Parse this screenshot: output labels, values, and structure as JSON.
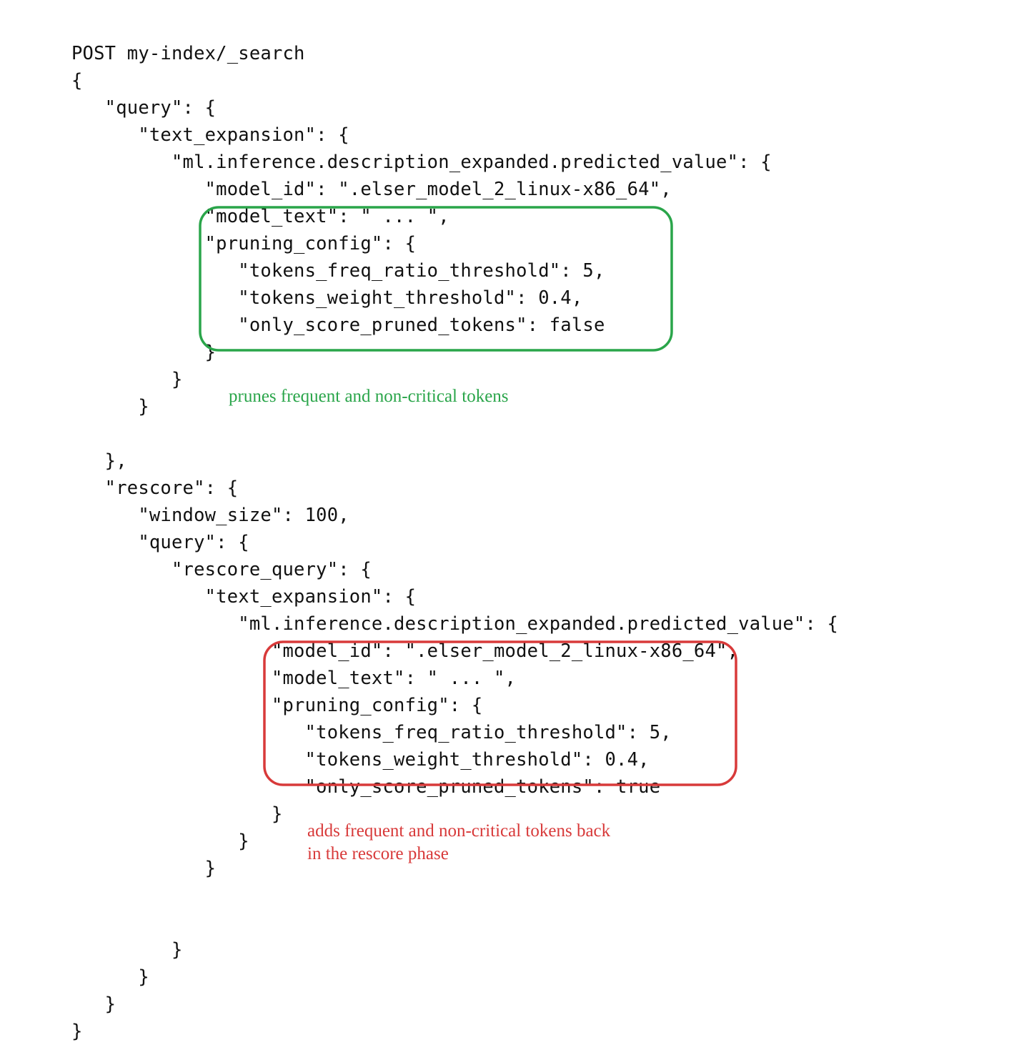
{
  "code_lines": [
    "POST my-index/_search",
    "{",
    "   \"query\": {",
    "      \"text_expansion\": {",
    "         \"ml.inference.description_expanded.predicted_value\": {",
    "            \"model_id\": \".elser_model_2_linux-x86_64\",",
    "            \"model_text\": \" ... \",",
    "            \"pruning_config\": {",
    "               \"tokens_freq_ratio_threshold\": 5,",
    "               \"tokens_weight_threshold\": 0.4,",
    "               \"only_score_pruned_tokens\": false",
    "            }",
    "         }",
    "      }",
    "   },",
    "   \"rescore\": {",
    "      \"window_size\": 100,",
    "      \"query\": {",
    "         \"rescore_query\": {",
    "            \"text_expansion\": {",
    "               \"ml.inference.description_expanded.predicted_value\": {",
    "                  \"model_id\": \".elser_model_2_linux-x86_64\",",
    "                  \"model_text\": \" ... \",",
    "                  \"pruning_config\": {",
    "                     \"tokens_freq_ratio_threshold\": 5,",
    "                     \"tokens_weight_threshold\": 0.4,",
    "                     \"only_score_pruned_tokens\": true",
    "                  }",
    "               }",
    "            }",
    "         }",
    "      }",
    "   }",
    "}"
  ],
  "annotations": {
    "green": "prunes frequent and non-critical tokens",
    "red_line1": "adds frequent and non-critical tokens back",
    "red_line2": "in the rescore phase"
  },
  "query_data": {
    "endpoint": "POST my-index/_search",
    "query": {
      "text_expansion_field": "ml.inference.description_expanded.predicted_value",
      "model_id": ".elser_model_2_linux-x86_64",
      "model_text": " ... ",
      "pruning_config": {
        "tokens_freq_ratio_threshold": 5,
        "tokens_weight_threshold": 0.4,
        "only_score_pruned_tokens": false
      }
    },
    "rescore": {
      "window_size": 100,
      "rescore_query": {
        "text_expansion_field": "ml.inference.description_expanded.predicted_value",
        "model_id": ".elser_model_2_linux-x86_64",
        "model_text": " ... ",
        "pruning_config": {
          "tokens_freq_ratio_threshold": 5,
          "tokens_weight_threshold": 0.4,
          "only_score_pruned_tokens": true
        }
      }
    }
  }
}
